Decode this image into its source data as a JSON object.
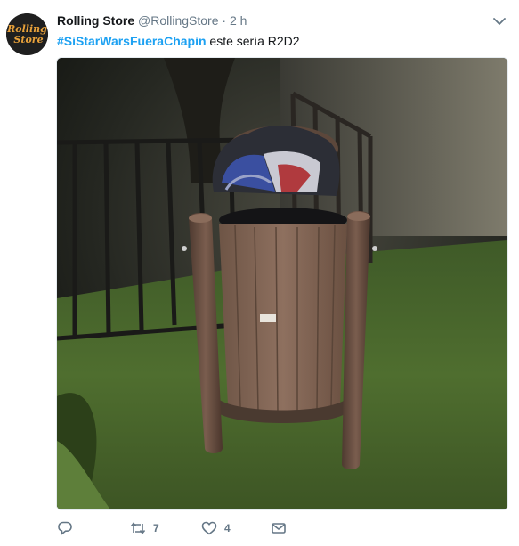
{
  "tweet": {
    "avatar_text_line1": "Rolling",
    "avatar_text_line2": "Store",
    "name": "Rolling Store",
    "handle": "@RollingStore",
    "separator": "·",
    "time": "2 h",
    "hashtag": "#SiStarWarsFueraChapin",
    "text": " este sería R2D2",
    "media_icon": "photo-trash-bin",
    "actions": {
      "reply_icon": "reply-icon",
      "retweet_icon": "retweet-icon",
      "retweet_count": "7",
      "like_icon": "heart-icon",
      "like_count": "4",
      "dm_icon": "envelope-icon"
    },
    "colors": {
      "link": "#1da1f2",
      "secondary": "#657786",
      "primary": "#14171a"
    }
  }
}
